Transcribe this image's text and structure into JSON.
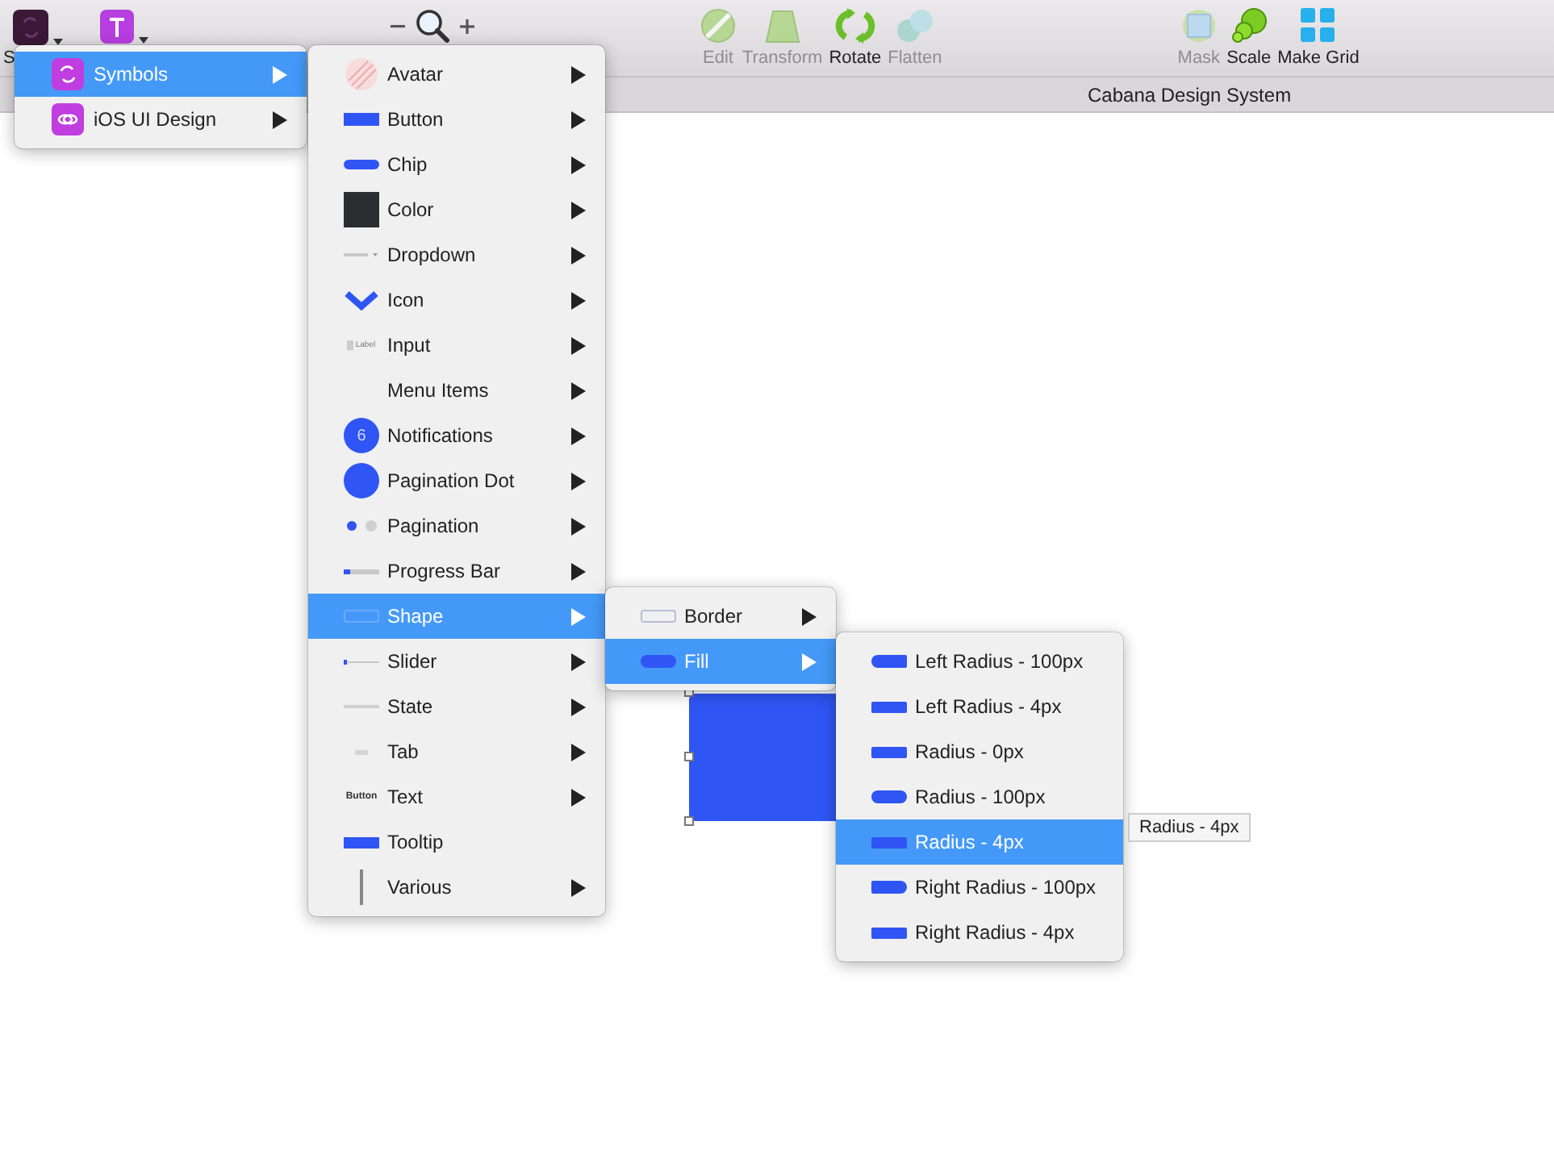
{
  "toolbar": {
    "insert_label": "S",
    "tools": [
      {
        "label": "Edit",
        "kind": "edit",
        "disabled": true
      },
      {
        "label": "Transform",
        "kind": "transform",
        "disabled": true
      },
      {
        "label": "Rotate",
        "kind": "rotate",
        "disabled": false
      },
      {
        "label": "Flatten",
        "kind": "flatten",
        "disabled": true
      },
      {
        "label": "Mask",
        "kind": "mask",
        "disabled": true
      },
      {
        "label": "Scale",
        "kind": "scale",
        "disabled": false
      },
      {
        "label": "Make Grid",
        "kind": "grid",
        "disabled": false
      }
    ]
  },
  "document_title": "Cabana Design System",
  "menus": [
    {
      "items": [
        {
          "label": "Symbols",
          "kind": "app-symbols",
          "selected": true,
          "submenu": true
        },
        {
          "label": "iOS UI Design",
          "kind": "app-ios",
          "selected": false,
          "submenu": true
        }
      ]
    },
    {
      "items": [
        {
          "label": "Avatar",
          "kind": "avatar",
          "selected": false,
          "submenu": true
        },
        {
          "label": "Button",
          "kind": "button",
          "selected": false,
          "submenu": true
        },
        {
          "label": "Chip",
          "kind": "chip",
          "selected": false,
          "submenu": true
        },
        {
          "label": "Color",
          "kind": "color",
          "selected": false,
          "submenu": true
        },
        {
          "label": "Dropdown",
          "kind": "dropdown",
          "selected": false,
          "submenu": true
        },
        {
          "label": "Icon",
          "kind": "chevron",
          "selected": false,
          "submenu": true
        },
        {
          "label": "Input",
          "kind": "input",
          "thumb_text": "Label",
          "selected": false,
          "submenu": true
        },
        {
          "label": "Menu Items",
          "kind": "plain",
          "selected": false,
          "submenu": true
        },
        {
          "label": "Notifications",
          "kind": "notification",
          "thumb_text": "6",
          "selected": false,
          "submenu": true
        },
        {
          "label": "Pagination Dot",
          "kind": "dot",
          "selected": false,
          "submenu": true
        },
        {
          "label": "Pagination",
          "kind": "pagination",
          "selected": false,
          "submenu": true
        },
        {
          "label": "Progress Bar",
          "kind": "progress",
          "selected": false,
          "submenu": true
        },
        {
          "label": "Shape",
          "kind": "shape",
          "selected": true,
          "submenu": true
        },
        {
          "label": "Slider",
          "kind": "slider",
          "selected": false,
          "submenu": true
        },
        {
          "label": "State",
          "kind": "state",
          "selected": false,
          "submenu": true
        },
        {
          "label": "Tab",
          "kind": "tab",
          "selected": false,
          "submenu": true
        },
        {
          "label": "Text",
          "kind": "text",
          "thumb_text": "Button",
          "selected": false,
          "submenu": true
        },
        {
          "label": "Tooltip",
          "kind": "tooltip",
          "selected": false,
          "submenu": false
        },
        {
          "label": "Various",
          "kind": "various",
          "selected": false,
          "submenu": true
        }
      ]
    },
    {
      "items": [
        {
          "label": "Border",
          "kind": "border",
          "selected": false,
          "submenu": true
        },
        {
          "label": "Fill",
          "kind": "pill",
          "selected": true,
          "submenu": true
        }
      ]
    },
    {
      "items": [
        {
          "label": "Left Radius - 100px",
          "kind": "pill-left",
          "selected": false,
          "submenu": false
        },
        {
          "label": "Left Radius - 4px",
          "kind": "rect",
          "selected": false,
          "submenu": false
        },
        {
          "label": "Radius - 0px",
          "kind": "rect",
          "selected": false,
          "submenu": false
        },
        {
          "label": "Radius - 100px",
          "kind": "pill",
          "selected": false,
          "submenu": false
        },
        {
          "label": "Radius - 4px",
          "kind": "rect",
          "selected": true,
          "submenu": false
        },
        {
          "label": "Right Radius - 100px",
          "kind": "pill-right",
          "selected": false,
          "submenu": false
        },
        {
          "label": "Right Radius - 4px",
          "kind": "rect",
          "selected": false,
          "submenu": false
        }
      ]
    }
  ],
  "tooltip": "Radius - 4px"
}
